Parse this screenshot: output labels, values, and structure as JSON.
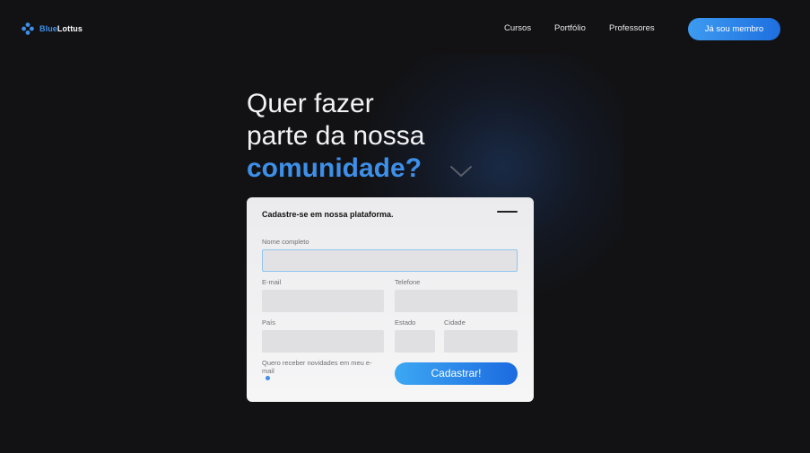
{
  "brand": {
    "name_part1": "Blue",
    "name_part2": "Lottus"
  },
  "nav": {
    "items": [
      "Cursos",
      "Portfólio",
      "Professores"
    ],
    "cta_label": "Já sou membro"
  },
  "hero": {
    "line1": "Quer fazer",
    "line2": "parte da nossa",
    "line3": "comunidade?"
  },
  "form": {
    "title": "Cadastre-se em nossa plataforma.",
    "fields": {
      "name_label": "Nome completo",
      "email_label": "E-mail",
      "phone_label": "Telefone",
      "country_label": "País",
      "state_label": "Estado",
      "city_label": "Cidade"
    },
    "newsletter_label": "Quero receber novidades em meu e-mail",
    "submit_label": "Cadastrar!"
  },
  "colors": {
    "accent": "#3d8fe8",
    "background": "#121214",
    "card": "#f2f2f3",
    "input": "#e0e0e2"
  },
  "icons": {
    "logo": "flower-cross-icon",
    "chevron": "chevron-down-icon",
    "minimize": "minimize-icon"
  }
}
